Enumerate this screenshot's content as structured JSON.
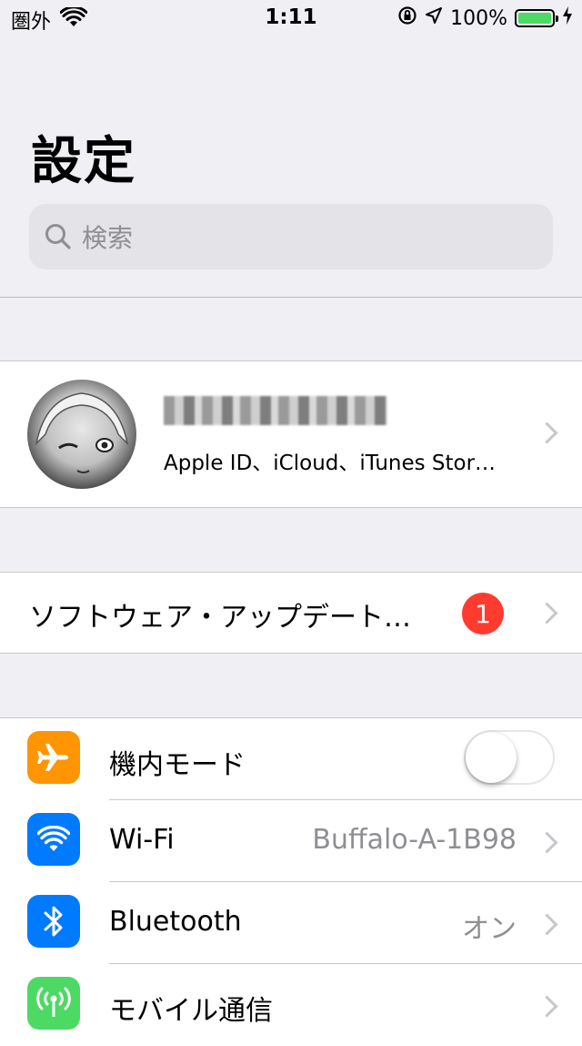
{
  "status_bar": {
    "carrier": "圏外",
    "time": "1:11",
    "battery_percent": "100%",
    "battery_level": 1.0,
    "battery_color": "#4cd964"
  },
  "header": {
    "title": "設定",
    "search_placeholder": "検索"
  },
  "profile": {
    "subtitle": "Apple ID、iCloud、iTunes Stor…"
  },
  "software_update": {
    "label": "ソフトウェア・アップデート…",
    "badge": "1",
    "badge_color": "#ff3b30"
  },
  "settings": [
    {
      "label": "機内モード",
      "icon": "airplane-icon",
      "color": "#ff9500",
      "value": "",
      "toggle": false
    },
    {
      "label": "Wi-Fi",
      "icon": "wifi-icon",
      "color": "#007aff",
      "value": "Buffalo-A-1B98"
    },
    {
      "label": "Bluetooth",
      "icon": "bluetooth-icon",
      "color": "#007aff",
      "value": "オン"
    },
    {
      "label": "モバイル通信",
      "icon": "cellular-icon",
      "color": "#4cd964",
      "value": ""
    }
  ]
}
